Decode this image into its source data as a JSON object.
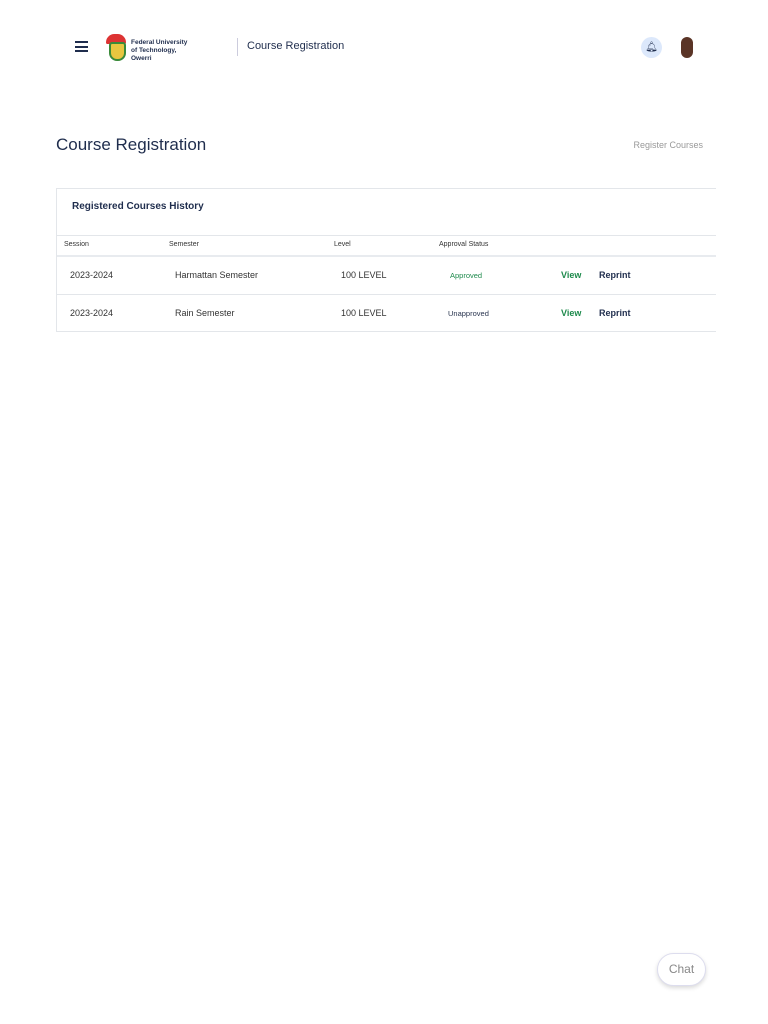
{
  "header": {
    "logo_text": "Federal University of Technology, Owerri",
    "title": "Course Registration"
  },
  "page": {
    "title": "Course Registration",
    "register_link": "Register Courses"
  },
  "card": {
    "title": "Registered Courses History",
    "columns": [
      "Session",
      "Semester",
      "Level",
      "Approval Status"
    ],
    "rows": [
      {
        "session": "2023-2024",
        "semester": "Harmattan Semester",
        "level": "100 LEVEL",
        "status": "Approved",
        "view": "View",
        "reprint": "Reprint"
      },
      {
        "session": "2023-2024",
        "semester": "Rain Semester",
        "level": "100 LEVEL",
        "status": "Unapproved",
        "view": "View",
        "reprint": "Reprint"
      }
    ]
  },
  "chat": {
    "label": "Chat"
  }
}
